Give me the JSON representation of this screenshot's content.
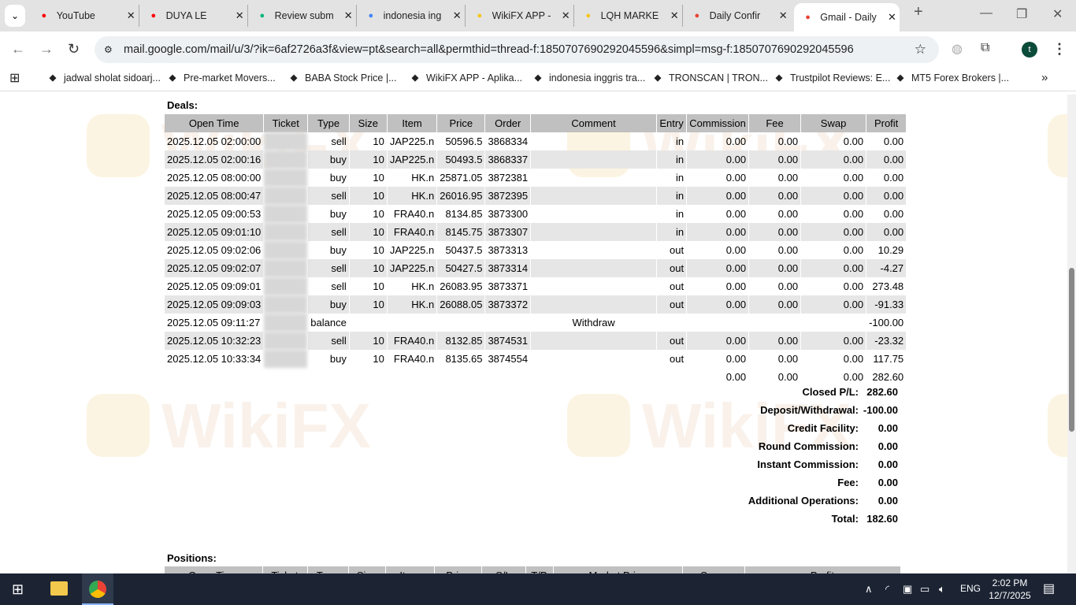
{
  "browser": {
    "tabs": [
      {
        "title": "YouTube",
        "icon": "youtube-icon",
        "color": "#ff0000"
      },
      {
        "title": "DUYA LE",
        "icon": "youtube-icon",
        "color": "#ff0000"
      },
      {
        "title": "Review subm",
        "icon": "trustpilot-star-icon",
        "color": "#00b67a"
      },
      {
        "title": "indonesia ing",
        "icon": "google-icon",
        "color": "#4285f4"
      },
      {
        "title": "WikiFX APP -",
        "icon": "wikifx-icon",
        "color": "#f5c518"
      },
      {
        "title": "LQH MARKE",
        "icon": "wikifx-icon",
        "color": "#f5c518"
      },
      {
        "title": "Daily Confir",
        "icon": "gmail-icon",
        "color": "#ea4335"
      },
      {
        "title": "Gmail - Daily",
        "icon": "gmail-icon",
        "color": "#ea4335"
      }
    ],
    "url": "mail.google.com/mail/u/3/?ik=6af2726a3f&view=pt&search=all&permthid=thread-f:1850707690292045596&simpl=msg-f:1850707690292045596",
    "profile_initial": "t",
    "bookmarks": [
      {
        "title": "jadwal sholat sidoarj...",
        "icon": "google-icon"
      },
      {
        "title": "Pre-market Movers...",
        "icon": "investing-icon"
      },
      {
        "title": "BABA Stock Price |...",
        "icon": "marketwatch-icon"
      },
      {
        "title": "WikiFX APP - Aplika...",
        "icon": "wikifx-icon"
      },
      {
        "title": "indonesia inggris tra...",
        "icon": "google-icon"
      },
      {
        "title": "TRONSCAN | TRON...",
        "icon": "tronscan-icon"
      },
      {
        "title": "Trustpilot Reviews: E...",
        "icon": "trustpilot-star-icon"
      },
      {
        "title": "MT5 Forex Brokers |...",
        "icon": "brokers-icon"
      }
    ]
  },
  "watermark": "WikiFX",
  "deals": {
    "title": "Deals:",
    "columns": [
      "Open Time",
      "Ticket",
      "Type",
      "Size",
      "Item",
      "Price",
      "Order",
      "Comment",
      "Entry",
      "Commission",
      "Fee",
      "Swap",
      "Profit"
    ],
    "rows": [
      [
        "2025.12.05 02:00:00",
        "",
        "sell",
        "10",
        "JAP225.n",
        "50596.5",
        "3868334",
        "",
        "in",
        "0.00",
        "0.00",
        "0.00",
        "0.00"
      ],
      [
        "2025.12.05 02:00:16",
        "",
        "buy",
        "10",
        "JAP225.n",
        "50493.5",
        "3868337",
        "",
        "in",
        "0.00",
        "0.00",
        "0.00",
        "0.00"
      ],
      [
        "2025.12.05 08:00:00",
        "",
        "buy",
        "10",
        "HK.n",
        "25871.05",
        "3872381",
        "",
        "in",
        "0.00",
        "0.00",
        "0.00",
        "0.00"
      ],
      [
        "2025.12.05 08:00:47",
        "",
        "sell",
        "10",
        "HK.n",
        "26016.95",
        "3872395",
        "",
        "in",
        "0.00",
        "0.00",
        "0.00",
        "0.00"
      ],
      [
        "2025.12.05 09:00:53",
        "",
        "buy",
        "10",
        "FRA40.n",
        "8134.85",
        "3873300",
        "",
        "in",
        "0.00",
        "0.00",
        "0.00",
        "0.00"
      ],
      [
        "2025.12.05 09:01:10",
        "",
        "sell",
        "10",
        "FRA40.n",
        "8145.75",
        "3873307",
        "",
        "in",
        "0.00",
        "0.00",
        "0.00",
        "0.00"
      ],
      [
        "2025.12.05 09:02:06",
        "",
        "buy",
        "10",
        "JAP225.n",
        "50437.5",
        "3873313",
        "",
        "out",
        "0.00",
        "0.00",
        "0.00",
        "10.29"
      ],
      [
        "2025.12.05 09:02:07",
        "",
        "sell",
        "10",
        "JAP225.n",
        "50427.5",
        "3873314",
        "",
        "out",
        "0.00",
        "0.00",
        "0.00",
        "-4.27"
      ],
      [
        "2025.12.05 09:09:01",
        "",
        "sell",
        "10",
        "HK.n",
        "26083.95",
        "3873371",
        "",
        "out",
        "0.00",
        "0.00",
        "0.00",
        "273.48"
      ],
      [
        "2025.12.05 09:09:03",
        "",
        "buy",
        "10",
        "HK.n",
        "26088.05",
        "3873372",
        "",
        "out",
        "0.00",
        "0.00",
        "0.00",
        "-91.33"
      ],
      [
        "2025.12.05 09:11:27",
        "",
        "balance",
        "",
        "",
        "",
        "",
        "Withdraw",
        "",
        "",
        "",
        "",
        "-100.00"
      ],
      [
        "2025.12.05 10:32:23",
        "",
        "sell",
        "10",
        "FRA40.n",
        "8132.85",
        "3874531",
        "",
        "out",
        "0.00",
        "0.00",
        "0.00",
        "-23.32"
      ],
      [
        "2025.12.05 10:33:34",
        "",
        "buy",
        "10",
        "FRA40.n",
        "8135.65",
        "3874554",
        "",
        "out",
        "0.00",
        "0.00",
        "0.00",
        "117.75"
      ]
    ],
    "totals": {
      "commission": "0.00",
      "fee": "0.00",
      "swap": "0.00",
      "profit": "282.60"
    },
    "summary": [
      {
        "label": "Closed P/L:",
        "value": "282.60"
      },
      {
        "label": "Deposit/Withdrawal:",
        "value": "-100.00"
      },
      {
        "label": "Credit Facility:",
        "value": "0.00"
      },
      {
        "label": "Round Commission:",
        "value": "0.00"
      },
      {
        "label": "Instant Commission:",
        "value": "0.00"
      },
      {
        "label": "Fee:",
        "value": "0.00"
      },
      {
        "label": "Additional Operations:",
        "value": "0.00"
      },
      {
        "label": "Total:",
        "value": "182.60"
      }
    ]
  },
  "positions": {
    "title": "Positions:",
    "columns": [
      "Open Time",
      "Ticket",
      "Type",
      "Size",
      "Item",
      "Price",
      "S/L",
      "T/P",
      "Market Price",
      "Swap",
      "Profit"
    ]
  },
  "taskbar": {
    "language": "ENG",
    "time": "2:02 PM",
    "date": "12/7/2025"
  }
}
